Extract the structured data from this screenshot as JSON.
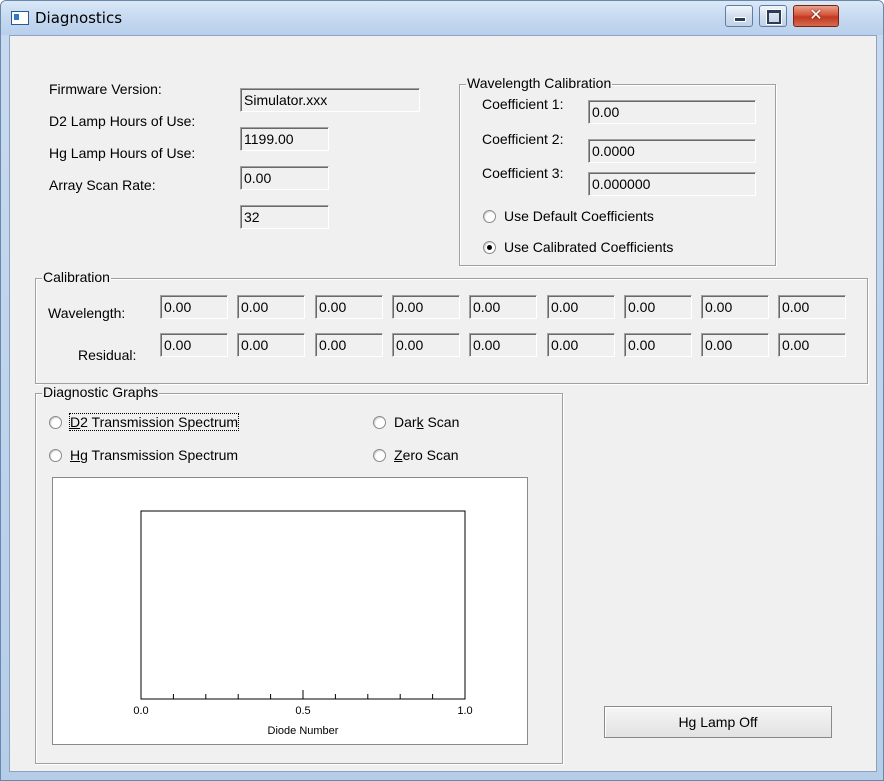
{
  "window": {
    "title": "Diagnostics"
  },
  "info": {
    "firmware_label": "Firmware Version:",
    "firmware_value": "Simulator.xxx",
    "d2_label": "D2 Lamp Hours of Use:",
    "d2_value": "1199.00",
    "hg_label": "Hg Lamp Hours of Use:",
    "hg_value": "0.00",
    "scan_label": "Array Scan Rate:",
    "scan_value": "32"
  },
  "wavelength_calibration": {
    "title": "Wavelength Calibration",
    "coef1_label": "Coefficient 1:",
    "coef1_value": "0.00",
    "coef2_label": "Coefficient 2:",
    "coef2_value": "0.0000",
    "coef3_label": "Coefficient 3:",
    "coef3_value": "0.000000",
    "default_option": "Use Default Coefficients",
    "calibrated_option": "Use Calibrated Coefficients",
    "selected": "calibrated"
  },
  "calibration": {
    "title": "Calibration",
    "wavelength_label": "Wavelength:",
    "residual_label": "Residual:",
    "wavelength_values": [
      "0.00",
      "0.00",
      "0.00",
      "0.00",
      "0.00",
      "0.00",
      "0.00",
      "0.00",
      "0.00"
    ],
    "residual_values": [
      "0.00",
      "0.00",
      "0.00",
      "0.00",
      "0.00",
      "0.00",
      "0.00",
      "0.00",
      "0.00"
    ]
  },
  "diagnostic_graphs": {
    "title": "Diagnostic Graphs",
    "options": {
      "d2": {
        "pre": "",
        "key": "D",
        "post": "2 Transmission Spectrum"
      },
      "hg": {
        "pre": "",
        "key": "H",
        "post": "g Transmission Spectrum"
      },
      "dark": {
        "pre": "Dar",
        "key": "k",
        "post": " Scan"
      },
      "zero": {
        "pre": "",
        "key": "Z",
        "post": "ero Scan"
      }
    },
    "selected": null,
    "focused": "d2"
  },
  "chart_data": {
    "type": "line",
    "title": "",
    "xlabel": "Diode Number",
    "ylabel": "",
    "xlim": [
      0.0,
      1.0
    ],
    "x_ticks": [
      "0.0",
      "0.5",
      "1.0"
    ],
    "series": []
  },
  "hg_lamp_button": {
    "label": "Hg Lamp Off"
  }
}
